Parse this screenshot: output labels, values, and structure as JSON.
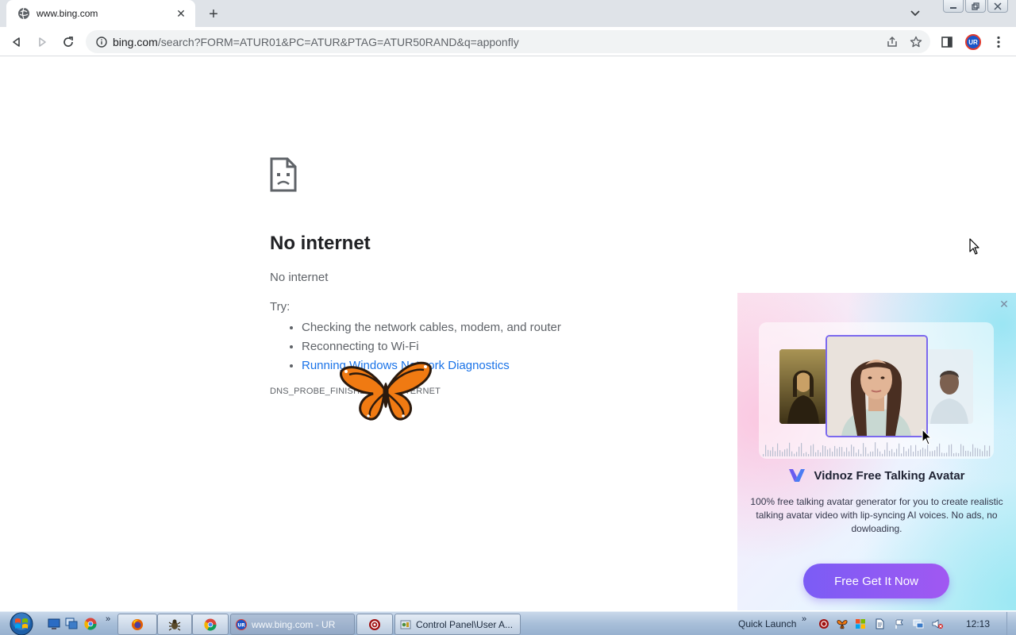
{
  "browser": {
    "tab": {
      "title": "www.bing.com",
      "favicon": "globe-icon"
    },
    "new_tab_symbol": "+",
    "tab_close_symbol": "✕",
    "url": {
      "host": "bing.com",
      "path": "/search?FORM=ATUR01&PC=ATUR&PTAG=ATUR50RAND&q=apponfly"
    },
    "profile_initials": "UR"
  },
  "error_page": {
    "title": "No internet",
    "subtitle": "No internet",
    "try_label": "Try:",
    "suggestions": [
      "Checking the network cables, modem, and router",
      "Reconnecting to Wi-Fi"
    ],
    "diagnostics_link": "Running Windows Network Diagnostics",
    "error_code": "DNS_PROBE_FINISHED_NO_INTERNET"
  },
  "ad": {
    "brand": "Vidnoz Free Talking Avatar",
    "description": "100% free talking avatar generator for you to create realistic talking avatar video with lip-syncing AI voices. No ads, no dowloading.",
    "cta": "Free Get It Now",
    "close_symbol": "✕",
    "accent_color": "#7b5cf5"
  },
  "taskbar": {
    "more_symbol": "»",
    "tasks": [
      {
        "label": "www.bing.com - UR",
        "icon": "ur-browser-icon",
        "active": true
      },
      {
        "label": "",
        "icon": "red-circle-app-icon",
        "active": false
      },
      {
        "label": "Control Panel\\User A...",
        "icon": "control-panel-icon",
        "active": false
      }
    ],
    "quick_launch_label": "Quick Launch",
    "clock": "12:13"
  }
}
